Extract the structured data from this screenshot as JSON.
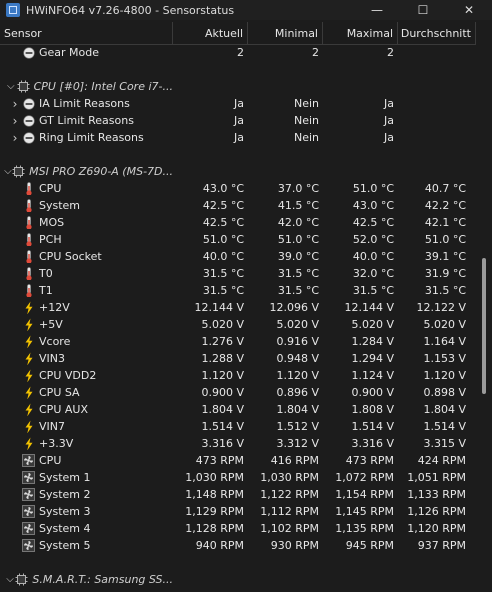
{
  "window": {
    "title": "HWiNFO64 v7.26-4800 - Sensorstatus",
    "minimize": "—",
    "maximize": "☐",
    "close": "✕"
  },
  "columns": [
    "Sensor",
    "Aktuell",
    "Minimal",
    "Maximal",
    "Durchschnitt"
  ],
  "rows": [
    {
      "type": "sensor",
      "indent": 1,
      "icon": "minus-circle-icon",
      "label": "Gear Mode",
      "v": [
        "2",
        "2",
        "2",
        ""
      ]
    },
    {
      "type": "spacer"
    },
    {
      "type": "group",
      "indent": 0,
      "label": "CPU [#0]: Intel Core i7-..."
    },
    {
      "type": "sensor",
      "indent": 1,
      "expand": true,
      "icon": "minus-circle-icon",
      "label": "IA Limit Reasons",
      "v": [
        "Ja",
        "Nein",
        "Ja",
        ""
      ]
    },
    {
      "type": "sensor",
      "indent": 1,
      "expand": true,
      "icon": "minus-circle-icon",
      "label": "GT Limit Reasons",
      "v": [
        "Ja",
        "Nein",
        "Ja",
        ""
      ]
    },
    {
      "type": "sensor",
      "indent": 1,
      "expand": true,
      "icon": "minus-circle-icon",
      "label": "Ring Limit Reasons",
      "v": [
        "Ja",
        "Nein",
        "Ja",
        ""
      ]
    },
    {
      "type": "spacer"
    },
    {
      "type": "group",
      "indent": 0,
      "label": "MSI PRO Z690-A (MS-7D..."
    },
    {
      "type": "sensor",
      "indent": 1,
      "icon": "thermometer-icon",
      "label": "CPU",
      "v": [
        "43.0 °C",
        "37.0 °C",
        "51.0 °C",
        "40.7 °C"
      ]
    },
    {
      "type": "sensor",
      "indent": 1,
      "icon": "thermometer-icon",
      "label": "System",
      "v": [
        "42.5 °C",
        "41.5 °C",
        "43.0 °C",
        "42.2 °C"
      ]
    },
    {
      "type": "sensor",
      "indent": 1,
      "icon": "thermometer-icon",
      "label": "MOS",
      "v": [
        "42.5 °C",
        "42.0 °C",
        "42.5 °C",
        "42.1 °C"
      ]
    },
    {
      "type": "sensor",
      "indent": 1,
      "icon": "thermometer-icon",
      "label": "PCH",
      "v": [
        "51.0 °C",
        "51.0 °C",
        "52.0 °C",
        "51.0 °C"
      ]
    },
    {
      "type": "sensor",
      "indent": 1,
      "icon": "thermometer-icon",
      "label": "CPU Socket",
      "v": [
        "40.0 °C",
        "39.0 °C",
        "40.0 °C",
        "39.1 °C"
      ]
    },
    {
      "type": "sensor",
      "indent": 1,
      "icon": "thermometer-icon",
      "label": "T0",
      "v": [
        "31.5 °C",
        "31.5 °C",
        "32.0 °C",
        "31.9 °C"
      ]
    },
    {
      "type": "sensor",
      "indent": 1,
      "icon": "thermometer-icon",
      "label": "T1",
      "v": [
        "31.5 °C",
        "31.5 °C",
        "31.5 °C",
        "31.5 °C"
      ]
    },
    {
      "type": "sensor",
      "indent": 1,
      "icon": "lightning-icon",
      "label": "+12V",
      "v": [
        "12.144 V",
        "12.096 V",
        "12.144 V",
        "12.122 V"
      ]
    },
    {
      "type": "sensor",
      "indent": 1,
      "icon": "lightning-icon",
      "label": "+5V",
      "v": [
        "5.020 V",
        "5.020 V",
        "5.020 V",
        "5.020 V"
      ]
    },
    {
      "type": "sensor",
      "indent": 1,
      "icon": "lightning-icon",
      "label": "Vcore",
      "v": [
        "1.276 V",
        "0.916 V",
        "1.284 V",
        "1.164 V"
      ]
    },
    {
      "type": "sensor",
      "indent": 1,
      "icon": "lightning-icon",
      "label": "VIN3",
      "v": [
        "1.288 V",
        "0.948 V",
        "1.294 V",
        "1.153 V"
      ]
    },
    {
      "type": "sensor",
      "indent": 1,
      "icon": "lightning-icon",
      "label": "CPU VDD2",
      "v": [
        "1.120 V",
        "1.120 V",
        "1.124 V",
        "1.120 V"
      ]
    },
    {
      "type": "sensor",
      "indent": 1,
      "icon": "lightning-icon",
      "label": "CPU SA",
      "v": [
        "0.900 V",
        "0.896 V",
        "0.900 V",
        "0.898 V"
      ]
    },
    {
      "type": "sensor",
      "indent": 1,
      "icon": "lightning-icon",
      "label": "CPU AUX",
      "v": [
        "1.804 V",
        "1.804 V",
        "1.808 V",
        "1.804 V"
      ]
    },
    {
      "type": "sensor",
      "indent": 1,
      "icon": "lightning-icon",
      "label": "VIN7",
      "v": [
        "1.514 V",
        "1.512 V",
        "1.514 V",
        "1.514 V"
      ]
    },
    {
      "type": "sensor",
      "indent": 1,
      "icon": "lightning-icon",
      "label": "+3.3V",
      "v": [
        "3.316 V",
        "3.312 V",
        "3.316 V",
        "3.315 V"
      ]
    },
    {
      "type": "sensor",
      "indent": 1,
      "icon": "fan-icon",
      "label": "CPU",
      "v": [
        "473 RPM",
        "416 RPM",
        "473 RPM",
        "424 RPM"
      ]
    },
    {
      "type": "sensor",
      "indent": 1,
      "icon": "fan-icon",
      "label": "System 1",
      "v": [
        "1,030 RPM",
        "1,030 RPM",
        "1,072 RPM",
        "1,051 RPM"
      ]
    },
    {
      "type": "sensor",
      "indent": 1,
      "icon": "fan-icon",
      "label": "System 2",
      "v": [
        "1,148 RPM",
        "1,122 RPM",
        "1,154 RPM",
        "1,133 RPM"
      ]
    },
    {
      "type": "sensor",
      "indent": 1,
      "icon": "fan-icon",
      "label": "System 3",
      "v": [
        "1,129 RPM",
        "1,112 RPM",
        "1,145 RPM",
        "1,126 RPM"
      ]
    },
    {
      "type": "sensor",
      "indent": 1,
      "icon": "fan-icon",
      "label": "System 4",
      "v": [
        "1,128 RPM",
        "1,102 RPM",
        "1,135 RPM",
        "1,120 RPM"
      ]
    },
    {
      "type": "sensor",
      "indent": 1,
      "icon": "fan-icon",
      "label": "System 5",
      "v": [
        "940 RPM",
        "930 RPM",
        "945 RPM",
        "937 RPM"
      ]
    },
    {
      "type": "spacer"
    },
    {
      "type": "group",
      "indent": 0,
      "label": "S.M.A.R.T.: Samsung SS..."
    }
  ],
  "colors": {
    "background": "#1c1c1c",
    "text": "#e6e6e6",
    "thermo_red": "#e04a3a",
    "lightning_yellow": "#f2c200"
  }
}
